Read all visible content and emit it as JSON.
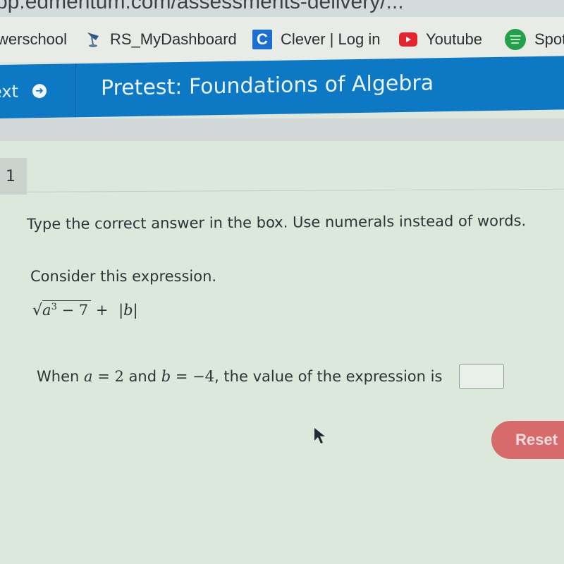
{
  "browser": {
    "url_fragment": "pp.edmentum.com/assessments-delivery/...",
    "bookmarks": [
      {
        "label": "werschool",
        "icon": "powerschool-icon"
      },
      {
        "label": "RS_MyDashboard",
        "icon": "rs-dashboard-icon"
      },
      {
        "label": "Clever | Log in",
        "icon": "clever-icon",
        "icon_glyph": "C"
      },
      {
        "label": "Youtube",
        "icon": "youtube-icon"
      },
      {
        "label": "Spot",
        "icon": "spotify-icon"
      }
    ]
  },
  "header": {
    "next_label": "ext",
    "next_icon": "arrow-circle-right-icon",
    "title": "Pretest: Foundations of Algebra",
    "color": "#0d78c4"
  },
  "question": {
    "number": "1",
    "instruction": "Type the correct answer in the box. Use numerals instead of words.",
    "prompt": "Consider this expression.",
    "expression": {
      "radical": "√",
      "base": "a",
      "exponent": "3",
      "minus_term": " − 7",
      "plus": " + ",
      "abs": "|b|"
    },
    "when": {
      "when": "When ",
      "a_var": "a",
      "eq1": " = ",
      "a_val": "2",
      "and": " and ",
      "b_var": "b",
      "eq2": " = ",
      "b_val": "−4",
      "tail": ", the value of the expression is"
    },
    "answer_value": "",
    "answer_placeholder": ""
  },
  "actions": {
    "reset_label": "Reset",
    "reset_color": "#d76b6b"
  }
}
